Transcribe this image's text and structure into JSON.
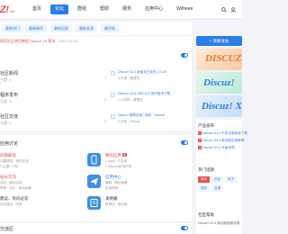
{
  "header": {
    "logo": "Z!",
    "logo_sub": "Disc",
    "nav": [
      {
        "label": "首页"
      },
      {
        "label": "论坛"
      },
      {
        "label": "群组"
      },
      {
        "label": "帮助"
      },
      {
        "label": "服务"
      },
      {
        "label": "应用中心"
      },
      {
        "label": "Witheee"
      }
    ]
  },
  "subnav": [
    "最新热门",
    "最新精华",
    "最新回复",
    "最新发表",
    "精华帖"
  ],
  "breadcrumb": {
    "text": "帮您社区使用教程 Discuz! X3 版本",
    "date": "2019-03-28"
  },
  "forums_section": {
    "items": [
      {
        "name": "社区新闻",
        "count": "主题: 3"
      },
      {
        "name": "程序发布",
        "count": "主题: 6"
      },
      {
        "name": "社区交流",
        "count": "主题: 9"
      }
    ],
    "posts": [
      {
        "title": "Discuz! X3.4 新版本已发布 3.4.20...",
        "meta": "4 天前 · 管理员",
        "count": "7"
      },
      {
        "title": "Discuz! X3.5 DISCUZ! 测试版本下载...",
        "meta": "1 小时前 · 管理员",
        "count": "2"
      },
      {
        "title": "Discuz! 推荐应用 / 插件 · Discuz! ...",
        "meta": "4 天前 · Discuz!",
        "count": "4"
      }
    ]
  },
  "apps_section": {
    "title": "应用讨论",
    "items": [
      {
        "name": "问题解答",
        "desc": "问题请求 · 常见反馈",
        "sub": "2 主题 · 3 帖"
      },
      {
        "name": "数码应用",
        "desc": "2 Apps · 5 技术",
        "sub": "1 Discuz!应用市场",
        "new": "新"
      },
      {
        "name": "站长交流",
        "desc": "站长 · 建站交流",
        "sub": "帮助 · 站长 · 网站运营"
      },
      {
        "name": "应用中心",
        "desc": "最新 · 精品推荐",
        "sub": "应用推荐"
      },
      {
        "name": "建议、有问必答",
        "desc": "社区建议 · 问答",
        "sub": ""
      },
      {
        "name": "发明箱",
        "desc": "新想法 · 新功能",
        "sub": ""
      }
    ]
  },
  "bottom_section": {
    "title": "交流区"
  },
  "sidebar": {
    "post_button": "+ 我要发帖",
    "ads": [
      {
        "text": "DISCUZ!"
      },
      {
        "text": "Discuz!"
      },
      {
        "text": "Discuz! X"
      }
    ],
    "products_title": "产品发布",
    "products": [
      {
        "n": "1",
        "text": "Discuz! X3.4 不定点更新版下载"
      },
      {
        "n": "2",
        "text": "Discuz! X3.4 新功能应用推荐"
      },
      {
        "n": "3",
        "text": "Discuz! X3.4 升级说明"
      }
    ],
    "tags_title": "热门话题",
    "tags": [
      "版本",
      "社区",
      "帖子",
      "插件",
      "应用"
    ],
    "help_title": "社区帮助",
    "help": [
      {
        "text": "Discuz! X3.4 新功能使用说明"
      }
    ]
  },
  "colors": {
    "accent": "#2b7de9",
    "brand_red": "#e84b4b",
    "bg": "#f2f4f8"
  }
}
